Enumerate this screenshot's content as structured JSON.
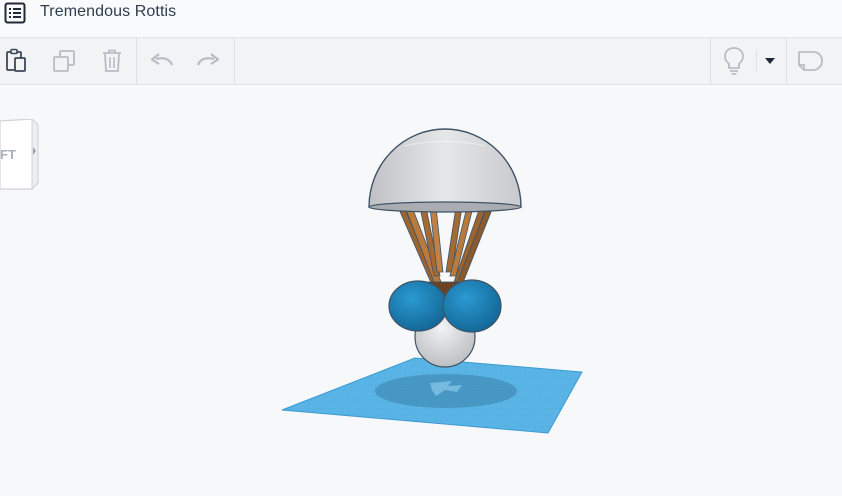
{
  "header": {
    "project_title": "Tremendous Rottis",
    "menu_icon": "list-icon"
  },
  "toolbar": {
    "buttons": [
      {
        "name": "paste-button",
        "icon": "clipboard-icon"
      },
      {
        "name": "duplicate-button",
        "icon": "duplicate-icon"
      },
      {
        "name": "delete-button",
        "icon": "trash-icon"
      },
      {
        "name": "undo-button",
        "icon": "undo-icon"
      },
      {
        "name": "redo-button",
        "icon": "redo-icon"
      },
      {
        "name": "light-bulb-button",
        "icon": "lightbulb-icon"
      },
      {
        "name": "dropdown-button",
        "icon": "caret-down-icon"
      },
      {
        "name": "note-button",
        "icon": "note-icon"
      }
    ]
  },
  "viewcube": {
    "face_label": "FT"
  },
  "colors": {
    "title_text": "#2f3e4e",
    "workplane": "#5ab5e6",
    "shape_blue": "#1c7fb4",
    "shape_gray": "#d8d9dc",
    "shape_brown": "#8a5a2c"
  }
}
